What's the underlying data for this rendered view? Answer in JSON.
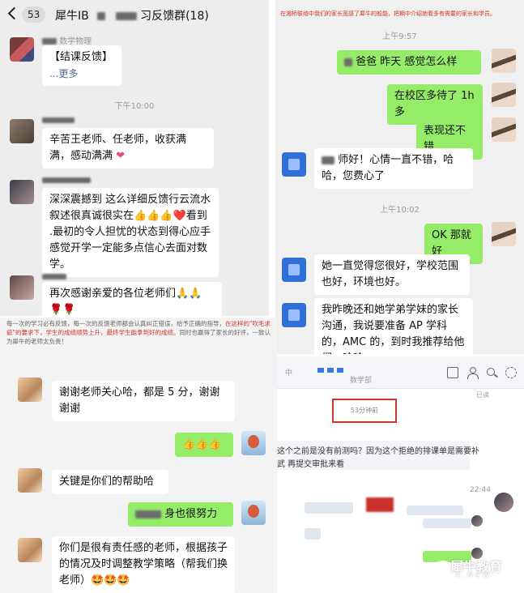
{
  "header": {
    "back_count": "53",
    "group_title_prefix": "犀牛IB",
    "group_title_suffix": "习反馈群(18)"
  },
  "panel1": {
    "sender1_name": "数学物理",
    "msg1_line1": "【结课反馈】",
    "msg1_more": "...更多",
    "time1": "下午10:00",
    "msg2": "辛苦王老师、任老师，收获满满，感动满满",
    "msg3": "深深震撼到 这么详细反馈行云流水 叙述很真诚很实在👍👍👍❤️看到   .最初的令人担忧的状态到得心应手感觉开学一定能多点信心去面对数学。",
    "msg4": "再次感谢亲爱的各位老师们🙏🙏🌹🌹"
  },
  "panel2": {
    "note_top": "在湘桥联络中我们的家长宽感了犀牛的般能，把期中介绍她看多有需要的家长和学员。",
    "time1": "上午9:57",
    "out1": "爸爸 昨天     感觉怎么样",
    "out2": "在校区多待了 1h 多",
    "out3": "表现还不错",
    "in1": "师好！心情一直不错，哈哈，您费心了",
    "time2": "上午10:02",
    "out4": "OK 那就好",
    "in2": "她一直觉得您很好，学校范围也好，环境也好。",
    "in3": "我昨晚还和她学弟学妹的家长沟通，我说要准备 AP 学科的，AMC 的，到时我推荐给他们，哈哈"
  },
  "panel3": {
    "note_part1": "每一次的学习必有反馈，每一次的反馈老师都会认真纠正错误，给予正确的指导，",
    "note_red1": "在这样的\"吹毛求疵\"的要求下，学生的成绩顺势上升，最终学生能拿到好的成绩。",
    "note_part2": "同时也赢得了家长的好评，一致认为犀牛的老师太负责！",
    "in1": "谢谢老师关心哈，都是 5 分，谢谢谢谢",
    "out1": "👍👍👍",
    "in2": "关键是你们的帮助哈",
    "out2": "身也很努力",
    "in3": "你们是很有责任感的老师，根据孩子的情况及时调整教学策略（帮我们换老师）🤩🤩🤩"
  },
  "panel4": {
    "tab_label": "数学部",
    "box_text": "53分钟前",
    "corner_text": "已读",
    "line1": "这个之前是没有前测吗？因为这个拒绝的排课单是需要补",
    "line2": "武 再提交审批来看",
    "time": "22:44"
  },
  "watermark": {
    "main": "犀牛教育",
    "sub": "X.NEW"
  },
  "icons": [
    "back-icon",
    "folder-icon",
    "user-icon",
    "search-icon",
    "gear-icon"
  ],
  "colors": {
    "outgoing_bubble": "#95ec69",
    "incoming_bubble": "#ffffff",
    "highlight_red": "#d0342c"
  }
}
